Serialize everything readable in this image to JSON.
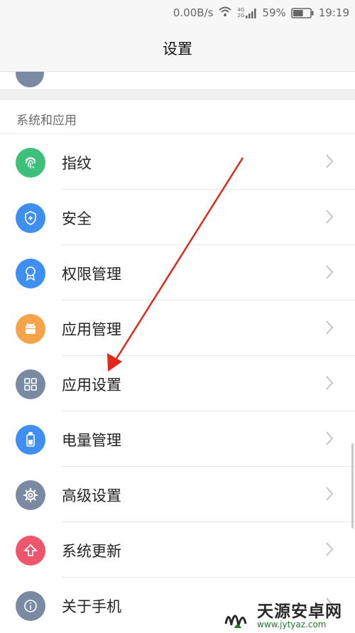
{
  "status_bar": {
    "network_speed": "0.00B/s",
    "network_type": "4G 2G",
    "battery_percent": "59%",
    "battery_level": 0.59,
    "time": "19:19",
    "icons": [
      "wifi-icon",
      "signal-icon",
      "battery-icon"
    ]
  },
  "header": {
    "title": "设置"
  },
  "section": {
    "label": "系统和应用"
  },
  "menu": [
    {
      "label": "指纹",
      "icon": "fingerprint-icon",
      "color": "#3cc07a"
    },
    {
      "label": "安全",
      "icon": "shield-icon",
      "color": "#3f8ef2"
    },
    {
      "label": "权限管理",
      "icon": "badge-icon",
      "color": "#3f8ef2"
    },
    {
      "label": "应用管理",
      "icon": "android-icon",
      "color": "#f5a44a"
    },
    {
      "label": "应用设置",
      "icon": "grid-icon",
      "color": "#7a8aa3"
    },
    {
      "label": "电量管理",
      "icon": "battery-icon",
      "color": "#3f8ef2"
    },
    {
      "label": "高级设置",
      "icon": "gear-icon",
      "color": "#7a8aa3"
    },
    {
      "label": "系统更新",
      "icon": "update-arrow-icon",
      "color": "#f0566b"
    },
    {
      "label": "关于手机",
      "icon": "info-icon",
      "color": "#7a8aa3"
    }
  ],
  "watermark": {
    "title": "天源安卓网",
    "url": "www.jytyaz.com",
    "accent_color": "#1f7a2a"
  },
  "annotation": {
    "arrow_color": "#e0281e"
  }
}
